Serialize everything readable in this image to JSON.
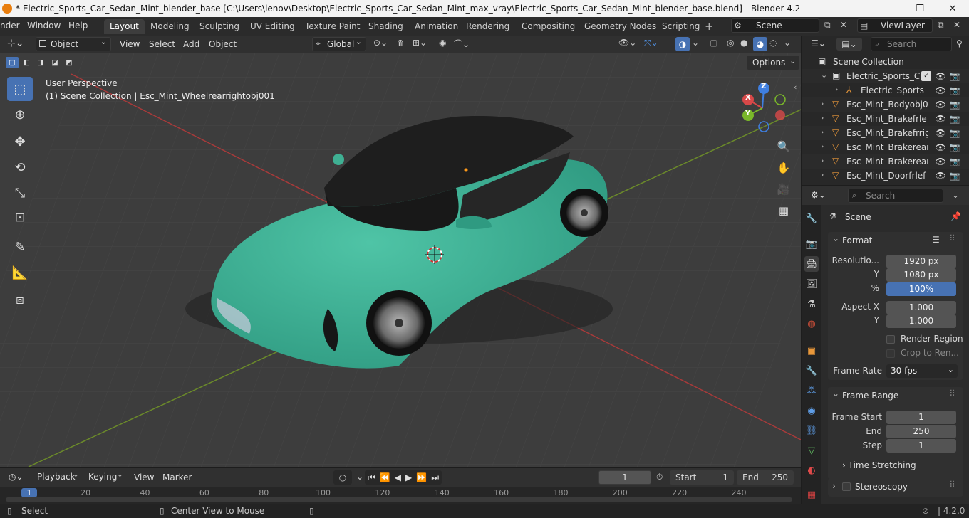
{
  "window": {
    "title": "* Electric_Sports_Car_Sedan_Mint_blender_base [C:\\Users\\lenov\\Desktop\\Electric_Sports_Car_Sedan_Mint_max_vray\\Electric_Sports_Car_Sedan_Mint_blender_base.blend] - Blender 4.2"
  },
  "menu": {
    "render": "nder",
    "window": "Window",
    "help": "Help"
  },
  "workspaces": [
    "Layout",
    "Modeling",
    "Sculpting",
    "UV Editing",
    "Texture Paint",
    "Shading",
    "Animation",
    "Rendering",
    "Compositing",
    "Geometry Nodes",
    "Scripting"
  ],
  "scene_field": "Scene",
  "view_layer_field": "ViewLayer",
  "viewport_header": {
    "mode": "Object Mode",
    "view": "View",
    "select": "Select",
    "add": "Add",
    "object": "Object",
    "orientation": "Global",
    "options": "Options"
  },
  "viewport_overlay": {
    "perspective": "User Perspective",
    "context": "(1) Scene Collection | Esc_Mint_Wheelrearrightobj001"
  },
  "gizmo": {
    "x": "X",
    "y": "Y",
    "z": "Z"
  },
  "outliner": {
    "search_placeholder": "Search",
    "root": "Scene Collection",
    "rows": [
      {
        "label": "Electric_Sports_Car",
        "indent": 1
      },
      {
        "label": "Electric_Sports_",
        "indent": 2
      },
      {
        "label": "Esc_Mint_Bodyobj0",
        "indent": 1
      },
      {
        "label": "Esc_Mint_Brakefrle",
        "indent": 1
      },
      {
        "label": "Esc_Mint_Brakefrrig",
        "indent": 1
      },
      {
        "label": "Esc_Mint_Brakerear",
        "indent": 1
      },
      {
        "label": "Esc_Mint_Brakerear",
        "indent": 1
      },
      {
        "label": "Esc_Mint_Doorfrlef",
        "indent": 1
      }
    ]
  },
  "properties": {
    "search_placeholder": "Search",
    "context": "Scene",
    "format": {
      "title": "Format",
      "resolution_label": "Resolutio...",
      "res_x": "1920 px",
      "y_label": "Y",
      "res_y": "1080 px",
      "pct_label": "%",
      "pct": "100%",
      "aspect_label": "Aspect X",
      "aspect_x": "1.000",
      "aspect_y": "1.000",
      "render_region": "Render Region",
      "crop": "Crop to Ren...",
      "frame_rate_label": "Frame Rate",
      "frame_rate": "30 fps"
    },
    "frame_range": {
      "title": "Frame Range",
      "start_label": "Frame Start",
      "start": "1",
      "end_label": "End",
      "end": "250",
      "step_label": "Step",
      "step": "1"
    },
    "time_stretching": "Time Stretching",
    "stereoscopy": "Stereoscopy"
  },
  "timeline": {
    "playback": "Playback",
    "keying": "Keying",
    "view": "View",
    "marker": "Marker",
    "current_frame": "1",
    "start_label": "Start",
    "start": "1",
    "end_label": "End",
    "end": "250",
    "ticks": [
      "1",
      "20",
      "40",
      "60",
      "80",
      "100",
      "120",
      "140",
      "160",
      "180",
      "200",
      "220",
      "240"
    ]
  },
  "statusbar": {
    "select": "Select",
    "center": "Center View to Mouse",
    "version": "4.2.0"
  }
}
